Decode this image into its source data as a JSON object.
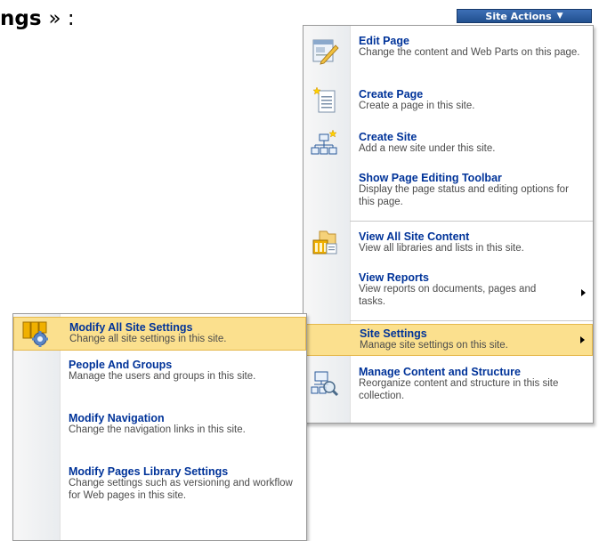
{
  "heading": {
    "partial": "ngs",
    "rest": "» :"
  },
  "site_actions": {
    "label": "Site Actions",
    "arrow": "▼"
  },
  "main_menu": [
    {
      "title": "Edit Page",
      "desc": "Change the content and Web Parts on this page.",
      "icon": "edit-page-icon"
    },
    {
      "title": "Create Page",
      "desc": "Create a page in this site.",
      "icon": "create-page-icon"
    },
    {
      "title": "Create Site",
      "desc": "Add a new site under this site.",
      "icon": "create-site-icon"
    },
    {
      "title": "Show Page Editing Toolbar",
      "desc": "Display the page status and editing options for this page.",
      "icon": ""
    },
    {
      "title": "View All Site Content",
      "desc": "View all libraries and lists in this site.",
      "icon": "view-all-site-content-icon"
    },
    {
      "title": "View Reports",
      "desc": "View reports on documents, pages and tasks.",
      "icon": ""
    },
    {
      "title": "Site Settings",
      "desc": "Manage site settings on this site.",
      "icon": ""
    },
    {
      "title": "Manage Content and Structure",
      "desc": "Reorganize content and structure in this site collection.",
      "icon": "manage-content-icon"
    }
  ],
  "sub_menu": [
    {
      "title": "Modify All Site Settings",
      "desc": "Change all site settings in this site.",
      "icon": "site-settings-gear-icon"
    },
    {
      "title": "People And Groups",
      "desc": "Manage the users and groups in this site."
    },
    {
      "title": "Modify Navigation",
      "desc": "Change the navigation links in this site."
    },
    {
      "title": "Modify Pages Library Settings",
      "desc": "Change settings such as versioning and workflow for Web pages in this site."
    }
  ],
  "colors": {
    "title": "#003399",
    "highlight": "#fbe08e",
    "button": "#2b5b9e"
  }
}
